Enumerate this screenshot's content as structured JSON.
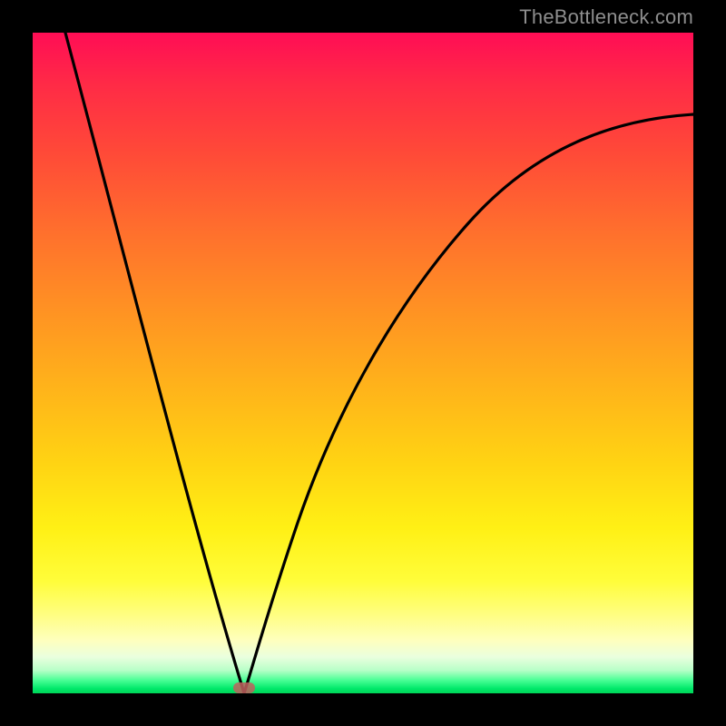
{
  "watermark": "TheBottleneck.com",
  "colors": {
    "background": "#000000",
    "gradient_top": "#ff0d55",
    "gradient_bottom": "#00d557",
    "curve": "#000000",
    "marker": "#bf605e"
  },
  "chart_data": {
    "type": "line",
    "title": "",
    "xlabel": "",
    "ylabel": "",
    "xlim": [
      0,
      100
    ],
    "ylim": [
      0,
      100
    ],
    "series": [
      {
        "name": "left-branch",
        "x": [
          4.9,
          7,
          10,
          13,
          16,
          19,
          22,
          25,
          27,
          29,
          30.5,
          31.5,
          32
        ],
        "y": [
          100,
          92,
          81,
          70,
          59,
          48,
          37,
          26,
          18,
          10,
          4,
          1,
          0
        ]
      },
      {
        "name": "right-branch",
        "x": [
          32,
          33,
          35,
          37,
          40,
          44,
          49,
          55,
          62,
          70,
          78,
          86,
          94,
          100
        ],
        "y": [
          0,
          2,
          8,
          15,
          25,
          37,
          49,
          59,
          67,
          73.5,
          78.5,
          82.5,
          85.5,
          87.5
        ]
      }
    ],
    "annotations": [
      {
        "name": "min-marker",
        "x": 32,
        "y": 0
      }
    ],
    "grid": false,
    "legend": false
  }
}
